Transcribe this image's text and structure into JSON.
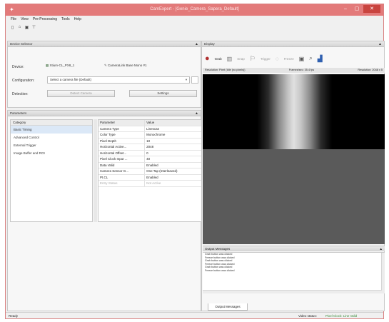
{
  "window": {
    "title": "CamExpert - [Genie_Camera_Sapera_Default]"
  },
  "menubar": [
    "File",
    "View",
    "Pre-Processing",
    "Tools",
    "Help"
  ],
  "toolbar_icons": [
    "new-file-icon",
    "open-folder-icon",
    "save-icon",
    "pin-icon"
  ],
  "device_selector": {
    "header": "Device Selector",
    "device_label": "Device:",
    "device_value": "Xtium-CL_PX8_1",
    "device2_value": "CameraLink Base Mono #1",
    "configuration_label": "Configuration:",
    "configuration_value": "Select a camera file (Default)",
    "detection_label": "Detection:",
    "detect_button": "Detect Camera",
    "settings_button": "Settings"
  },
  "parameters": {
    "header": "Parameters",
    "category_header": "Category",
    "categories": [
      "Basic Timing",
      "Advanced Control",
      "External Trigger",
      "Image Buffer and ROI"
    ],
    "selected_category": 0,
    "columns": [
      "Parameter",
      "Value"
    ],
    "rows": [
      {
        "name": "Camera Type",
        "value": "Linescan"
      },
      {
        "name": "Color Type",
        "value": "Monochrome"
      },
      {
        "name": "Pixel Depth",
        "value": "10"
      },
      {
        "name": "Horizontal Active...",
        "value": "2048"
      },
      {
        "name": "Horizontal Offset...",
        "value": "0"
      },
      {
        "name": "Pixel Clock Input ...",
        "value": "40"
      },
      {
        "name": "Data Valid",
        "value": "Enabled"
      },
      {
        "name": "Camera Sensor G...",
        "value": "One Tap (Interleaved)"
      },
      {
        "name": "Pt.CL",
        "value": "Enabled"
      },
      {
        "name": "Entry Status",
        "value": "Not Active"
      }
    ]
  },
  "display": {
    "header": "Display",
    "toolbar_labels": {
      "grab": "Grab",
      "snap": "Snap",
      "trigger": "Trigger",
      "freeze": "Freeze"
    },
    "info_left": "Resolution: Pixel (Idle (no pixels))",
    "info_mid": "Frames/sec: 35.4 fps",
    "info_right": "Resolution: 2048 x 5"
  },
  "output_messages": {
    "header": "Output Messages",
    "lines": [
      "Grab button was clicked",
      "Freeze button was clicked",
      "Grab button was clicked",
      "Freeze button was clicked",
      "Grab button was clicked",
      "Freeze button was clicked"
    ],
    "tab_label": "Output Messages"
  },
  "statusbar": {
    "left": "Ready",
    "video_status_label": "Video status:",
    "video_status_value": "Pixel Clock: Line Valid"
  },
  "colors": {
    "title_bar": "#e37a7a",
    "close_button": "#c9443f",
    "status_value": "#3a8a3a"
  }
}
